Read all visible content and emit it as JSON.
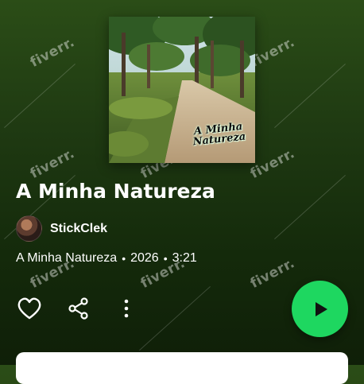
{
  "colors": {
    "background_top": "#2b4d17",
    "background_bottom": "#0f1f08",
    "accent_play": "#1ed760",
    "text": "#ffffff"
  },
  "cover": {
    "title_line1": "A Minha",
    "title_line2": "Natureza"
  },
  "song": {
    "title": "A Minha Natureza"
  },
  "artist": {
    "name": "StickClek"
  },
  "meta": {
    "album": "A Minha Natureza",
    "year": "2026",
    "duration": "3:21"
  },
  "watermark": {
    "text": "fiverr."
  },
  "icons": {
    "like": "heart-icon",
    "share": "share-icon",
    "more": "more-vertical-icon",
    "play": "play-icon"
  }
}
